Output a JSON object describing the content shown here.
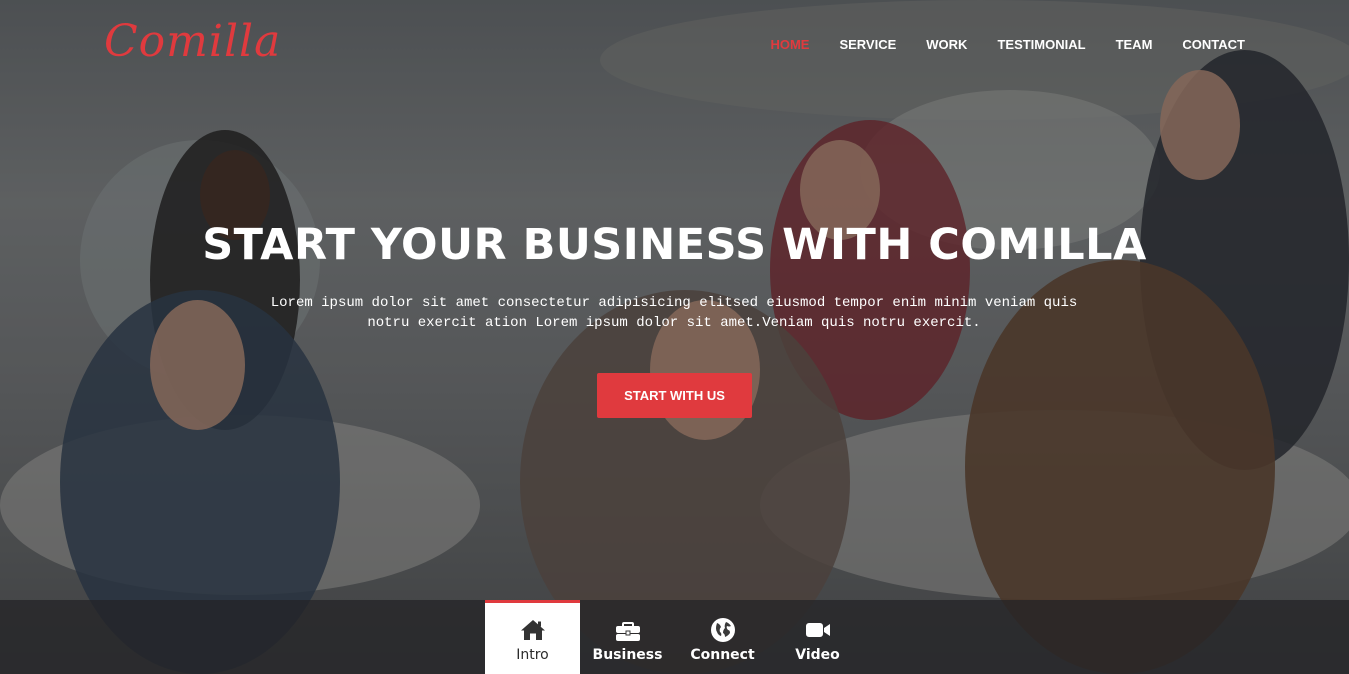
{
  "brand": {
    "logo_text": "Comilla",
    "accent_color": "#e03a3e"
  },
  "nav": {
    "items": [
      {
        "label": "HOME",
        "active": true
      },
      {
        "label": "SERVICE",
        "active": false
      },
      {
        "label": "WORK",
        "active": false
      },
      {
        "label": "TESTIMONIAL",
        "active": false
      },
      {
        "label": "TEAM",
        "active": false
      },
      {
        "label": "CONTACT",
        "active": false
      }
    ]
  },
  "hero": {
    "title": "START YOUR BUSINESS WITH COMILLA",
    "description_line1": "Lorem ipsum dolor sit amet consectetur adipisicing elitsed eiusmod tempor enim minim veniam quis",
    "description_line2": "notru exercit ation Lorem ipsum dolor sit amet.Veniam quis notru exercit.",
    "cta_label": "START WITH US"
  },
  "tabs": [
    {
      "label": "Intro",
      "icon": "home-icon",
      "active": true
    },
    {
      "label": "Business",
      "icon": "briefcase-icon",
      "active": false
    },
    {
      "label": "Connect",
      "icon": "globe-icon",
      "active": false
    },
    {
      "label": "Video",
      "icon": "video-camera-icon",
      "active": false
    }
  ]
}
